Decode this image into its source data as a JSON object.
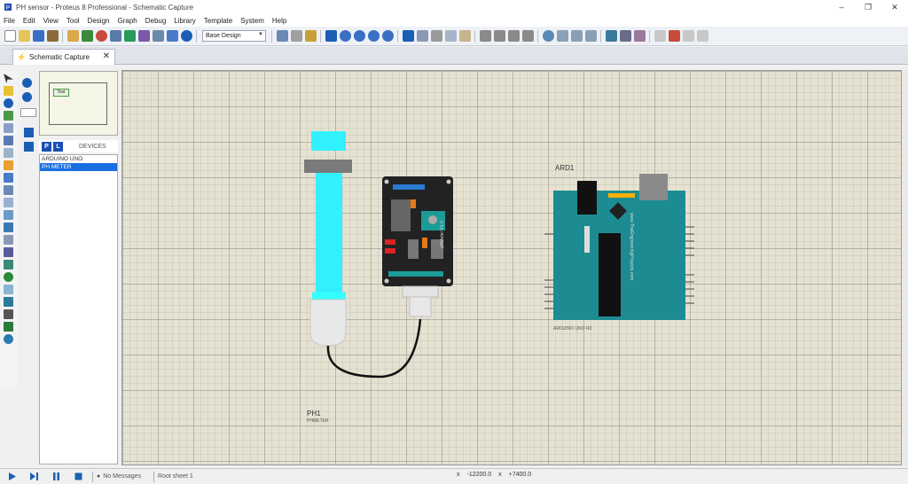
{
  "window": {
    "title": "PH sensor - Proteus 8 Professional - Schematic Capture",
    "minimize": "–",
    "maximize": "❐",
    "close": "✕"
  },
  "menu": [
    "File",
    "Edit",
    "View",
    "Tool",
    "Design",
    "Graph",
    "Debug",
    "Library",
    "Template",
    "System",
    "Help"
  ],
  "toolbar": {
    "design_select": "Base Design"
  },
  "tab": {
    "label": "Schematic Capture"
  },
  "overview": {
    "tag": "Text"
  },
  "devices": {
    "p_button": "P",
    "l_button": "L",
    "header": "DEVICES",
    "items": [
      "ARDUINO UNO",
      "PH METER"
    ]
  },
  "schematic": {
    "arduino_ref": "ARD1",
    "arduino_part": "ARDUINO UNO R3",
    "ph_ref": "PH1",
    "ph_part": "PHMETER",
    "board_label": "pHMeter V1.0"
  },
  "status": {
    "messages": "No Messages",
    "sheet": "Root sheet 1",
    "x_label": "x",
    "x_value": "-12200.0",
    "y_label": "x",
    "y_value": "+7400.0"
  }
}
